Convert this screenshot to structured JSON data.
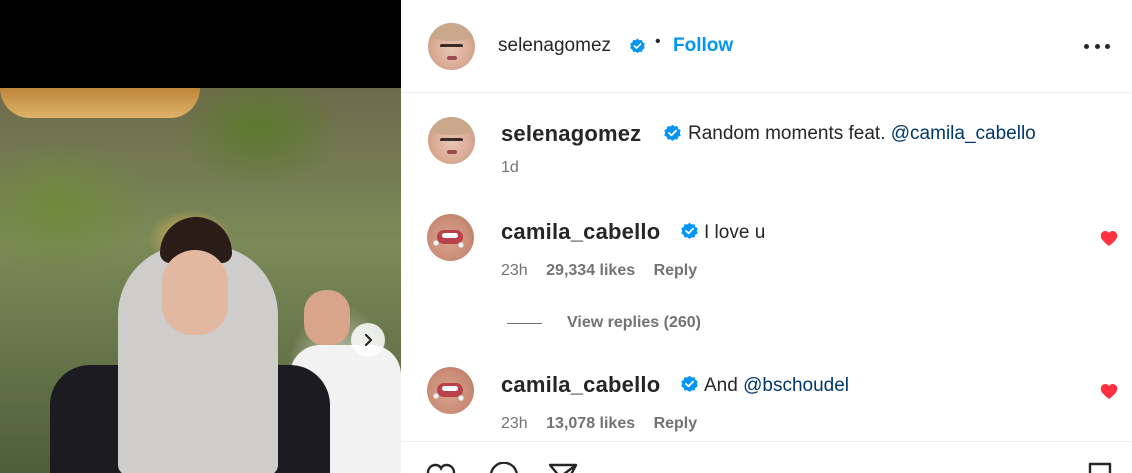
{
  "post": {
    "author": "selenagomez",
    "dot": "•",
    "follow_label": "Follow",
    "caption": {
      "username": "selenagomez",
      "text": "Random moments feat. ",
      "mention": "@camila_cabello",
      "time": "1d"
    }
  },
  "comments": [
    {
      "username": "camila_cabello",
      "text": "I love u",
      "mention": "",
      "time": "23h",
      "likes": "29,334 likes",
      "reply_label": "Reply",
      "liked": true
    },
    {
      "username": "camila_cabello",
      "text": "And ",
      "mention": "@bschoudel",
      "time": "23h",
      "likes": "13,078 likes",
      "reply_label": "Reply",
      "liked": true
    }
  ],
  "view_replies_label": "View replies (260)",
  "colors": {
    "follow": "#0095f6",
    "verified": "#0095f6",
    "heart": "#ff3040",
    "mention": "#00376b"
  },
  "icons": [
    "verified-badge-icon",
    "more-options-icon",
    "heart-icon",
    "chevron-right-icon",
    "comment-icon",
    "share-icon",
    "bookmark-icon"
  ]
}
